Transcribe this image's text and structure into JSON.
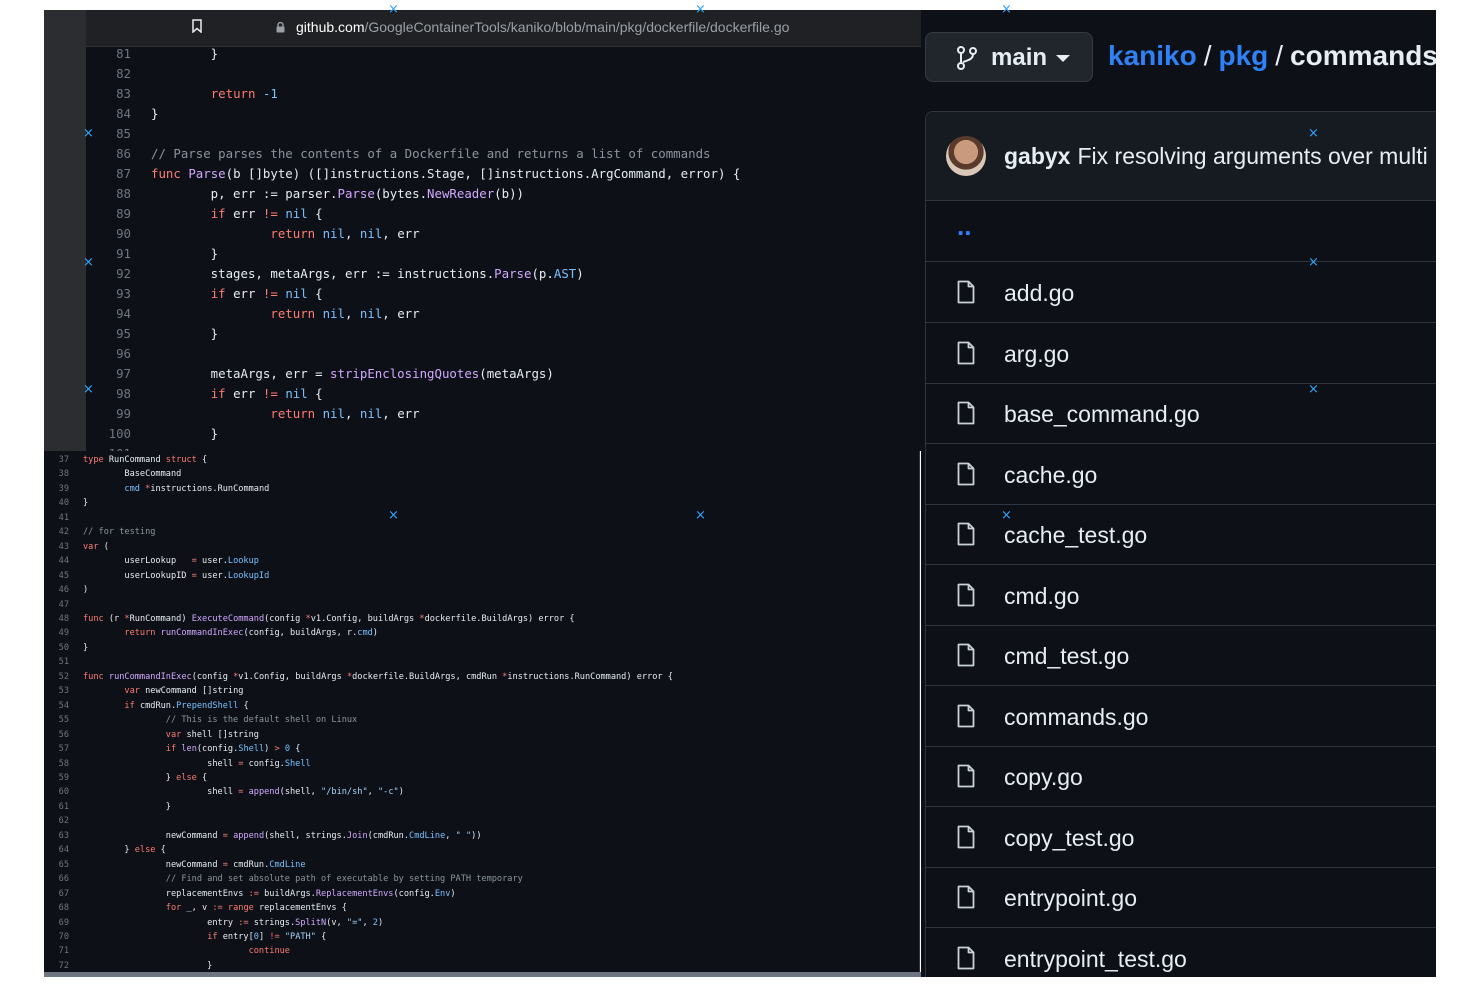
{
  "browser": {
    "url_host": "github.com",
    "url_path": "/GoogleContainerTools/kaniko/blob/main/pkg/dockerfile/dockerfile.go"
  },
  "editor_top": {
    "lines": [
      {
        "n": "81",
        "t": [
          [
            "",
            "        }"
          ]
        ]
      },
      {
        "n": "82",
        "t": [
          [
            "",
            ""
          ]
        ]
      },
      {
        "n": "83",
        "t": [
          [
            "",
            "        "
          ],
          [
            "kw",
            "return"
          ],
          [
            "",
            " "
          ],
          [
            "nu",
            "-1"
          ]
        ]
      },
      {
        "n": "84",
        "t": [
          [
            "",
            "}"
          ]
        ]
      },
      {
        "n": "85",
        "t": [
          [
            "",
            ""
          ]
        ]
      },
      {
        "n": "86",
        "t": [
          [
            "cm",
            "// Parse parses the contents of a Dockerfile and returns a list of commands"
          ]
        ]
      },
      {
        "n": "87",
        "t": [
          [
            "kw",
            "func"
          ],
          [
            "",
            " "
          ],
          [
            "fn",
            "Parse"
          ],
          [
            "",
            "(b []byte) ([]instructions.Stage, []instructions.ArgCommand, error) {"
          ]
        ]
      },
      {
        "n": "88",
        "t": [
          [
            "",
            "        p, err := parser."
          ],
          [
            "fn",
            "Parse"
          ],
          [
            "",
            "(bytes."
          ],
          [
            "fn",
            "NewReader"
          ],
          [
            "",
            "(b))"
          ]
        ]
      },
      {
        "n": "89",
        "t": [
          [
            "",
            "        "
          ],
          [
            "kw",
            "if"
          ],
          [
            "",
            " err "
          ],
          [
            "kw",
            "!="
          ],
          [
            "",
            " "
          ],
          [
            "nu",
            "nil"
          ],
          [
            "",
            " {"
          ]
        ]
      },
      {
        "n": "90",
        "t": [
          [
            "",
            "                "
          ],
          [
            "kw",
            "return"
          ],
          [
            "",
            " "
          ],
          [
            "nu",
            "nil"
          ],
          [
            "",
            ", "
          ],
          [
            "nu",
            "nil"
          ],
          [
            "",
            ", err"
          ]
        ]
      },
      {
        "n": "91",
        "t": [
          [
            "",
            "        }"
          ]
        ]
      },
      {
        "n": "92",
        "t": [
          [
            "",
            "        stages, metaArgs, err := instructions."
          ],
          [
            "fn",
            "Parse"
          ],
          [
            "",
            "(p."
          ],
          [
            "pr",
            "AST"
          ],
          [
            "",
            ")"
          ]
        ]
      },
      {
        "n": "93",
        "t": [
          [
            "",
            "        "
          ],
          [
            "kw",
            "if"
          ],
          [
            "",
            " err "
          ],
          [
            "kw",
            "!="
          ],
          [
            "",
            " "
          ],
          [
            "nu",
            "nil"
          ],
          [
            "",
            " {"
          ]
        ]
      },
      {
        "n": "94",
        "t": [
          [
            "",
            "                "
          ],
          [
            "kw",
            "return"
          ],
          [
            "",
            " "
          ],
          [
            "nu",
            "nil"
          ],
          [
            "",
            ", "
          ],
          [
            "nu",
            "nil"
          ],
          [
            "",
            ", err"
          ]
        ]
      },
      {
        "n": "95",
        "t": [
          [
            "",
            "        }"
          ]
        ]
      },
      {
        "n": "96",
        "t": [
          [
            "",
            ""
          ]
        ]
      },
      {
        "n": "97",
        "t": [
          [
            "",
            "        metaArgs, err = "
          ],
          [
            "fn",
            "stripEnclosingQuotes"
          ],
          [
            "",
            "(metaArgs)"
          ]
        ]
      },
      {
        "n": "98",
        "t": [
          [
            "",
            "        "
          ],
          [
            "kw",
            "if"
          ],
          [
            "",
            " err "
          ],
          [
            "kw",
            "!="
          ],
          [
            "",
            " "
          ],
          [
            "nu",
            "nil"
          ],
          [
            "",
            " {"
          ]
        ]
      },
      {
        "n": "99",
        "t": [
          [
            "",
            "                "
          ],
          [
            "kw",
            "return"
          ],
          [
            "",
            " "
          ],
          [
            "nu",
            "nil"
          ],
          [
            "",
            ", "
          ],
          [
            "nu",
            "nil"
          ],
          [
            "",
            ", err"
          ]
        ]
      },
      {
        "n": "100",
        "t": [
          [
            "",
            "        }"
          ]
        ]
      },
      {
        "n": "101",
        "t": [
          [
            "",
            ""
          ]
        ]
      }
    ]
  },
  "editor_bottom": {
    "lines": [
      {
        "n": "37",
        "t": [
          [
            "kw",
            "type"
          ],
          [
            "",
            " RunCommand "
          ],
          [
            "kw",
            "struct"
          ],
          [
            "",
            " {"
          ]
        ]
      },
      {
        "n": "38",
        "t": [
          [
            "",
            "        BaseCommand"
          ]
        ]
      },
      {
        "n": "39",
        "t": [
          [
            "",
            "        "
          ],
          [
            "pr",
            "cmd"
          ],
          [
            "",
            " "
          ],
          [
            "kw",
            "*"
          ],
          [
            "",
            "instructions.RunCommand"
          ]
        ]
      },
      {
        "n": "40",
        "t": [
          [
            "",
            "}"
          ]
        ]
      },
      {
        "n": "41",
        "t": [
          [
            "",
            ""
          ]
        ]
      },
      {
        "n": "42",
        "t": [
          [
            "cm",
            "// for testing"
          ]
        ]
      },
      {
        "n": "43",
        "t": [
          [
            "kw",
            "var"
          ],
          [
            "",
            " ("
          ]
        ]
      },
      {
        "n": "44",
        "t": [
          [
            "",
            "        userLookup   "
          ],
          [
            "kw",
            "="
          ],
          [
            "",
            " user."
          ],
          [
            "pr",
            "Lookup"
          ]
        ]
      },
      {
        "n": "45",
        "t": [
          [
            "",
            "        userLookupID "
          ],
          [
            "kw",
            "="
          ],
          [
            "",
            " user."
          ],
          [
            "pr",
            "LookupId"
          ]
        ]
      },
      {
        "n": "46",
        "t": [
          [
            "",
            ")"
          ]
        ]
      },
      {
        "n": "47",
        "t": [
          [
            "",
            ""
          ]
        ]
      },
      {
        "n": "48",
        "t": [
          [
            "kw",
            "func"
          ],
          [
            "",
            " (r "
          ],
          [
            "kw",
            "*"
          ],
          [
            "",
            "RunCommand) "
          ],
          [
            "fn",
            "ExecuteCommand"
          ],
          [
            "",
            "(config "
          ],
          [
            "kw",
            "*"
          ],
          [
            "",
            "v1.Config, buildArgs "
          ],
          [
            "kw",
            "*"
          ],
          [
            "",
            "dockerfile.BuildArgs) error {"
          ]
        ]
      },
      {
        "n": "49",
        "t": [
          [
            "",
            "        "
          ],
          [
            "kw",
            "return"
          ],
          [
            "",
            " "
          ],
          [
            "fn",
            "runCommandInExec"
          ],
          [
            "",
            "(config, buildArgs, r."
          ],
          [
            "pr",
            "cmd"
          ],
          [
            "",
            ")"
          ]
        ]
      },
      {
        "n": "50",
        "t": [
          [
            "",
            "}"
          ]
        ]
      },
      {
        "n": "51",
        "t": [
          [
            "",
            ""
          ]
        ]
      },
      {
        "n": "52",
        "t": [
          [
            "kw",
            "func"
          ],
          [
            "",
            " "
          ],
          [
            "fn",
            "runCommandInExec"
          ],
          [
            "",
            "(config "
          ],
          [
            "kw",
            "*"
          ],
          [
            "",
            "v1.Config, buildArgs "
          ],
          [
            "kw",
            "*"
          ],
          [
            "",
            "dockerfile.BuildArgs, cmdRun "
          ],
          [
            "kw",
            "*"
          ],
          [
            "",
            "instructions.RunCommand) error {"
          ]
        ]
      },
      {
        "n": "53",
        "t": [
          [
            "",
            "        "
          ],
          [
            "kw",
            "var"
          ],
          [
            "",
            " newCommand []string"
          ]
        ]
      },
      {
        "n": "54",
        "t": [
          [
            "",
            "        "
          ],
          [
            "kw",
            "if"
          ],
          [
            "",
            " cmdRun."
          ],
          [
            "pr",
            "PrependShell"
          ],
          [
            "",
            " {"
          ]
        ]
      },
      {
        "n": "55",
        "t": [
          [
            "",
            "                "
          ],
          [
            "cm",
            "// This is the default shell on Linux"
          ]
        ]
      },
      {
        "n": "56",
        "t": [
          [
            "",
            "                "
          ],
          [
            "kw",
            "var"
          ],
          [
            "",
            " shell []string"
          ]
        ]
      },
      {
        "n": "57",
        "t": [
          [
            "",
            "                "
          ],
          [
            "kw",
            "if"
          ],
          [
            "",
            " "
          ],
          [
            "fn",
            "len"
          ],
          [
            "",
            "(config."
          ],
          [
            "pr",
            "Shell"
          ],
          [
            "",
            ") "
          ],
          [
            "kw",
            ">"
          ],
          [
            "",
            " "
          ],
          [
            "nu",
            "0"
          ],
          [
            "",
            " {"
          ]
        ]
      },
      {
        "n": "58",
        "t": [
          [
            "",
            "                        shell "
          ],
          [
            "kw",
            "="
          ],
          [
            "",
            " config."
          ],
          [
            "pr",
            "Shell"
          ]
        ]
      },
      {
        "n": "59",
        "t": [
          [
            "",
            "                } "
          ],
          [
            "kw",
            "else"
          ],
          [
            "",
            " {"
          ]
        ]
      },
      {
        "n": "60",
        "t": [
          [
            "",
            "                        shell "
          ],
          [
            "kw",
            "="
          ],
          [
            "",
            " "
          ],
          [
            "fn",
            "append"
          ],
          [
            "",
            "(shell, "
          ],
          [
            "st",
            "\"/bin/sh\""
          ],
          [
            "",
            ", "
          ],
          [
            "st",
            "\"-c\""
          ],
          [
            "",
            ")"
          ]
        ]
      },
      {
        "n": "61",
        "t": [
          [
            "",
            "                }"
          ]
        ]
      },
      {
        "n": "62",
        "t": [
          [
            "",
            ""
          ]
        ]
      },
      {
        "n": "63",
        "t": [
          [
            "",
            "                newCommand "
          ],
          [
            "kw",
            "="
          ],
          [
            "",
            " "
          ],
          [
            "fn",
            "append"
          ],
          [
            "",
            "(shell, strings."
          ],
          [
            "fn",
            "Join"
          ],
          [
            "",
            "(cmdRun."
          ],
          [
            "pr",
            "CmdLine"
          ],
          [
            "",
            ", "
          ],
          [
            "st",
            "\" \""
          ],
          [
            "",
            "))"
          ]
        ]
      },
      {
        "n": "64",
        "t": [
          [
            "",
            "        } "
          ],
          [
            "kw",
            "else"
          ],
          [
            "",
            " {"
          ]
        ]
      },
      {
        "n": "65",
        "t": [
          [
            "",
            "                newCommand "
          ],
          [
            "kw",
            "="
          ],
          [
            "",
            " cmdRun."
          ],
          [
            "pr",
            "CmdLine"
          ]
        ]
      },
      {
        "n": "66",
        "t": [
          [
            "",
            "                "
          ],
          [
            "cm",
            "// Find and set absolute path of executable by setting PATH temporary"
          ]
        ]
      },
      {
        "n": "67",
        "t": [
          [
            "",
            "                replacementEnvs "
          ],
          [
            "kw",
            ":="
          ],
          [
            "",
            " buildArgs."
          ],
          [
            "fn",
            "ReplacementEnvs"
          ],
          [
            "",
            "(config."
          ],
          [
            "pr",
            "Env"
          ],
          [
            "",
            ")"
          ]
        ]
      },
      {
        "n": "68",
        "t": [
          [
            "",
            "                "
          ],
          [
            "kw",
            "for"
          ],
          [
            "",
            " _, v "
          ],
          [
            "kw",
            ":="
          ],
          [
            "",
            " "
          ],
          [
            "kw",
            "range"
          ],
          [
            "",
            " replacementEnvs {"
          ]
        ]
      },
      {
        "n": "69",
        "t": [
          [
            "",
            "                        entry "
          ],
          [
            "kw",
            ":="
          ],
          [
            "",
            " strings."
          ],
          [
            "fn",
            "SplitN"
          ],
          [
            "",
            "(v, "
          ],
          [
            "st",
            "\"=\""
          ],
          [
            "",
            ", "
          ],
          [
            "nu",
            "2"
          ],
          [
            "",
            ")"
          ]
        ]
      },
      {
        "n": "70",
        "t": [
          [
            "",
            "                        "
          ],
          [
            "kw",
            "if"
          ],
          [
            "",
            " entry["
          ],
          [
            "nu",
            "0"
          ],
          [
            "",
            "] "
          ],
          [
            "kw",
            "!="
          ],
          [
            "",
            " "
          ],
          [
            "st",
            "\"PATH\""
          ],
          [
            "",
            " {"
          ]
        ]
      },
      {
        "n": "71",
        "t": [
          [
            "",
            "                                "
          ],
          [
            "kw",
            "continue"
          ]
        ]
      },
      {
        "n": "72",
        "t": [
          [
            "",
            "                        }"
          ]
        ]
      }
    ]
  },
  "github": {
    "branch": "main",
    "breadcrumb": [
      {
        "label": "kaniko",
        "link": true
      },
      {
        "label": "pkg",
        "link": true
      },
      {
        "label": "commands",
        "link": false
      }
    ],
    "commit": {
      "author": "gabyx",
      "message": "Fix resolving arguments over multi"
    },
    "parent_dir": "..",
    "files": [
      "add.go",
      "arg.go",
      "base_command.go",
      "cache.go",
      "cache_test.go",
      "cmd.go",
      "cmd_test.go",
      "commands.go",
      "copy.go",
      "copy_test.go",
      "entrypoint.go",
      "entrypoint_test.go"
    ]
  },
  "markers": {
    "glyph": "×"
  },
  "colors": {
    "accent_link": "#2f81f7",
    "marker": "#2ea6ff",
    "background": "#0d1117"
  }
}
